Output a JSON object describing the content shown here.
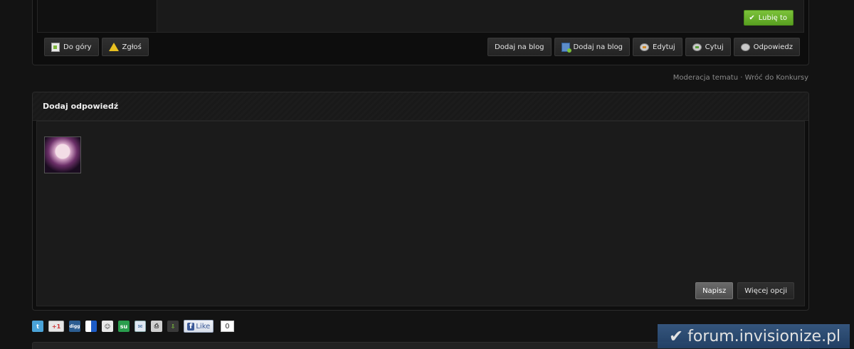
{
  "post": {
    "like_label": "Lubię to",
    "left_buttons": [
      {
        "label": "Do góry",
        "icon": "page-up-icon"
      },
      {
        "label": "Zgłoś",
        "icon": "warning-icon"
      }
    ],
    "right_buttons": [
      {
        "label": "Dodaj na blog",
        "icon": ""
      },
      {
        "label": "Dodaj na blog",
        "icon": "blog-icon"
      },
      {
        "label": "Edytuj",
        "icon": "edit-bubble-icon"
      },
      {
        "label": "Cytuj",
        "icon": "quote-bubble-icon"
      },
      {
        "label": "Odpowiedz",
        "icon": "reply-bubble-icon"
      }
    ]
  },
  "moderation": {
    "moderate_label": "Moderacja tematu",
    "separator": "·",
    "back_label": "Wróć do Konkursy"
  },
  "reply": {
    "title": "Dodaj odpowiedź",
    "submit_label": "Napisz",
    "more_label": "Więcej opcji"
  },
  "share": {
    "icons": [
      "twitter-icon",
      "google-plus-icon",
      "digg-icon",
      "delicious-icon",
      "reddit-icon",
      "stumbleupon-icon",
      "email-icon",
      "print-icon",
      "download-icon"
    ],
    "gplus_text": "+1",
    "digg_text": "digg",
    "stumble_text": "su",
    "fb_like_label": "Like",
    "fb_like_count": "0"
  },
  "watermark": {
    "text": "forum.invisionize.pl"
  }
}
